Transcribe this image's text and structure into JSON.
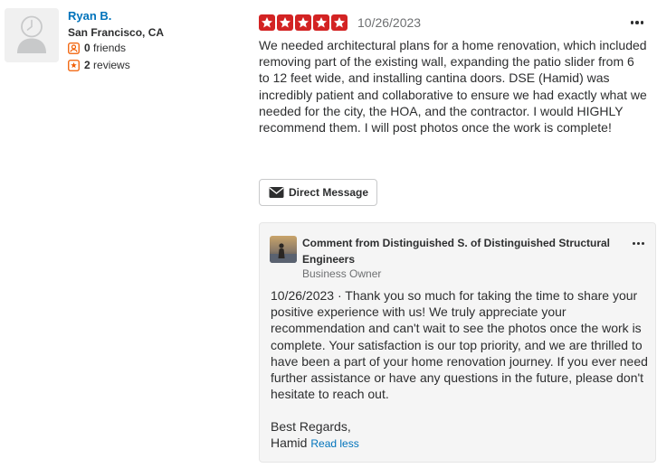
{
  "user": {
    "name": "Ryan B.",
    "location": "San Francisco, CA",
    "friends_count": "0",
    "friends_label": "friends",
    "reviews_count": "2",
    "reviews_label": "reviews",
    "avatar_icon": "default-user-icon"
  },
  "review": {
    "rating": 5,
    "rating_max": 5,
    "star_color": "#d32323",
    "date": "10/26/2023",
    "text": "We needed architectural plans for a home renovation, which included removing part of the existing wall, expanding the patio slider from 6 to 12 feet wide, and installing cantina doors. DSE (Hamid) was incredibly patient and collaborative to ensure we had exactly what we needed for the city, the HOA, and the contractor. I would HIGHLY recommend them. I will post photos once the work is complete!",
    "direct_message_label": "Direct Message",
    "direct_message_icon": "envelope-icon",
    "more_icon": "more-options-icon"
  },
  "owner_comment": {
    "heading": "Comment from Distinguished S. of Distinguished Structural Engineers",
    "role": "Business Owner",
    "date": "10/26/2023",
    "separator": "·",
    "text": "Thank you so much for taking the time to share your positive experience with us! We truly appreciate your recommendation and can't wait to see the photos once the work is complete. Your satisfaction is our top priority, and we are thrilled to have been a part of your home renovation journey. If you ever need further assistance or have any questions in the future, please don't hesitate to reach out.",
    "closing": "Best Regards,",
    "signature": "Hamid",
    "read_less_label": "Read less"
  },
  "colors": {
    "link": "#0073bb",
    "text": "#2d2e2f",
    "muted": "#6e7072",
    "stat_icon": "#f15c00"
  }
}
